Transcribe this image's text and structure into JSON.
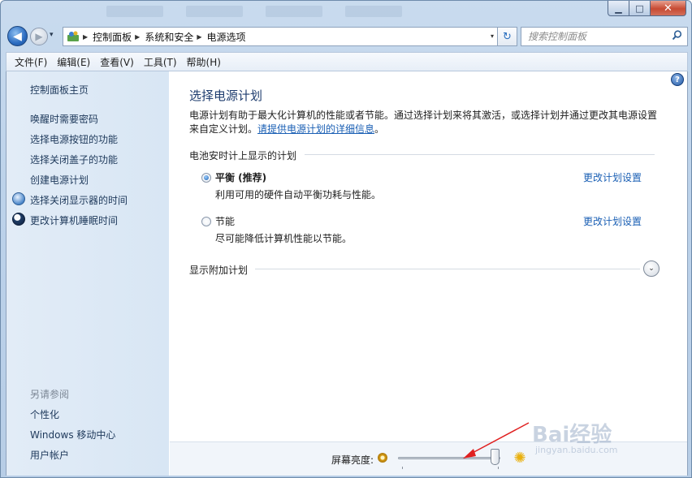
{
  "window": {
    "minimize": "▁",
    "maximize": "□",
    "close": "✕"
  },
  "nav": {
    "back": "◀",
    "forward": "▶",
    "recent": "▾",
    "breadcrumbs": [
      "控制面板",
      "系统和安全",
      "电源选项"
    ],
    "dropdown": "▾",
    "refresh": "↻",
    "search_placeholder": "搜索控制面板"
  },
  "menu": [
    "文件(F)",
    "编辑(E)",
    "查看(V)",
    "工具(T)",
    "帮助(H)"
  ],
  "sidebar": {
    "home": "控制面板主页",
    "links": [
      "唤醒时需要密码",
      "选择电源按钮的功能",
      "选择关闭盖子的功能",
      "创建电源计划",
      "选择关闭显示器的时间",
      "更改计算机睡眠时间"
    ],
    "see_also_title": "另请参阅",
    "see_also": [
      "个性化",
      "Windows 移动中心",
      "用户帐户"
    ]
  },
  "main": {
    "help": "?",
    "title": "选择电源计划",
    "description": "电源计划有助于最大化计算机的性能或者节能。通过选择计划来将其激活，或选择计划并通过更改其电源设置来自定义计划。",
    "description_link": "请提供电源计划的详细信息",
    "description_end": "。",
    "battery_group": "电池安时计上显示的计划",
    "plans": [
      {
        "name": "平衡 (推荐)",
        "desc": "利用可用的硬件自动平衡功耗与性能。",
        "link": "更改计划设置",
        "selected": true
      },
      {
        "name": "节能",
        "desc": "尽可能降低计算机性能以节能。",
        "link": "更改计划设置",
        "selected": false
      }
    ],
    "extra_group": "显示附加计划",
    "expand": "⌄"
  },
  "footer": {
    "brightness_label": "屏幕亮度:",
    "brightness_level": 0.95
  },
  "watermark": {
    "logo": "Bai经验",
    "url": "jingyan.baidu.com"
  },
  "colors": {
    "link": "#1a5fb4",
    "title": "#1e3c6e",
    "sidebar_link": "#1e395b",
    "annotation_arrow": "#e02020"
  }
}
